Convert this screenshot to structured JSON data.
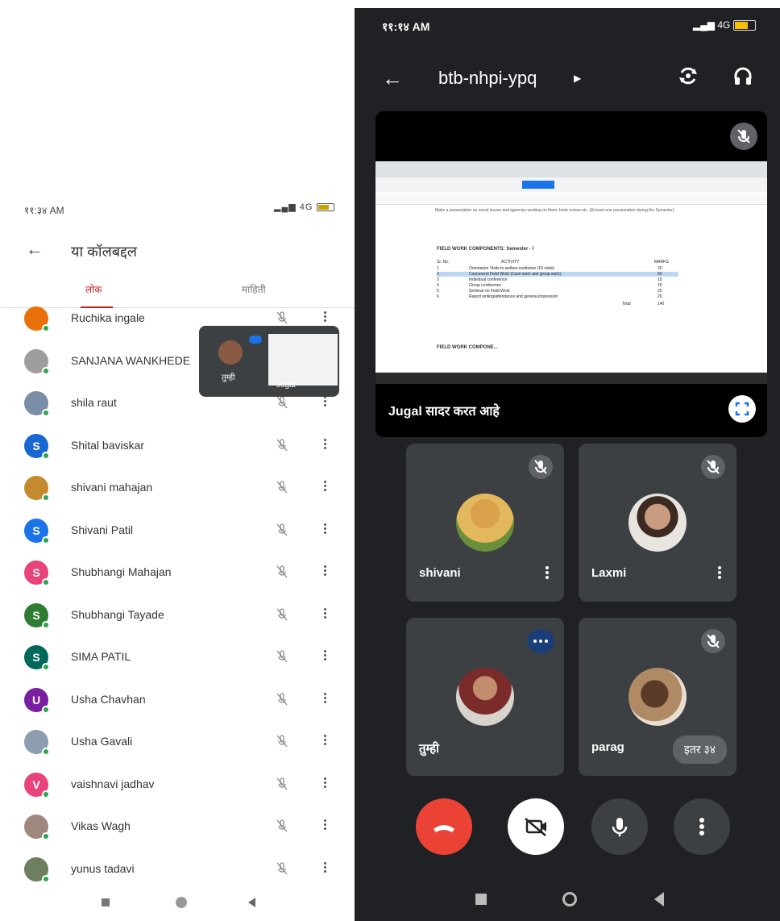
{
  "left_phone": {
    "status": {
      "time": "११:३४ AM",
      "signal": "4G"
    },
    "header": {
      "title": "या कॉलबद्दल"
    },
    "tabs": [
      {
        "label": "लोक",
        "active": true
      },
      {
        "label": "माहिती",
        "active": false
      }
    ],
    "participants": [
      {
        "name": "Ruchika ingale",
        "initial": "",
        "avatar_color": "#e8710a",
        "muted": true
      },
      {
        "name": "SANJANA WANKHEDE",
        "initial": "",
        "avatar_color": "#9e9e9e",
        "muted": true
      },
      {
        "name": "shila raut",
        "initial": "",
        "avatar_color": "#7a8fa6",
        "muted": true
      },
      {
        "name": "Shital baviskar",
        "initial": "S",
        "avatar_color": "#1967d2",
        "muted": true
      },
      {
        "name": "shivani mahajan",
        "initial": "",
        "avatar_color": "#c58a2e",
        "muted": true
      },
      {
        "name": "Shivani Patil",
        "initial": "S",
        "avatar_color": "#1a73e8",
        "muted": true
      },
      {
        "name": "Shubhangi Mahajan",
        "initial": "S",
        "avatar_color": "#e8437a",
        "muted": true
      },
      {
        "name": "Shubhangi Tayade",
        "initial": "S",
        "avatar_color": "#2e7d32",
        "muted": true
      },
      {
        "name": "SIMA PATIL",
        "initial": "S",
        "avatar_color": "#00695c",
        "muted": true
      },
      {
        "name": "Usha Chavhan",
        "initial": "U",
        "avatar_color": "#7b1fa2",
        "muted": true
      },
      {
        "name": "Usha Gavali",
        "initial": "",
        "avatar_color": "#8d9db0",
        "muted": true
      },
      {
        "name": "vaishnavi jadhav",
        "initial": "V",
        "avatar_color": "#e8437a",
        "muted": true
      },
      {
        "name": "Vikas Wagh",
        "initial": "",
        "avatar_color": "#a1887f",
        "muted": true
      },
      {
        "name": "yunus tadavi",
        "initial": "",
        "avatar_color": "#6d7f5f",
        "muted": true
      }
    ],
    "pip": {
      "self_label": "तुम्ही",
      "presenter_label": "Jugal"
    }
  },
  "right_phone": {
    "status": {
      "time": "११:१४ AM",
      "signal": "4G"
    },
    "meeting_code": "btb-nhpi-ypq",
    "presentation": {
      "caption": "Jugal सादर करत आहे",
      "doc_intro": "Make a presentation on social issues and agencies working on them; book review etc. (At least one presentation during the Semester)",
      "heading1": "FIELD WORK COMPONENTS: Semester - I",
      "table_headers": [
        "Sr. No.",
        "ACTIVITY",
        "MARKS"
      ],
      "table_rows": [
        {
          "no": "1",
          "activity": "Orientation Visits to welfare institution (10 visits)",
          "marks": "20"
        },
        {
          "no": "2",
          "activity": "Concurrent Field Work (Case work and group work)",
          "marks": "50"
        },
        {
          "no": "3",
          "activity": "Individual conference",
          "marks": "15"
        },
        {
          "no": "4",
          "activity": "Group conference",
          "marks": "15"
        },
        {
          "no": "5",
          "activity": "Seminar on Field Work",
          "marks": "20"
        },
        {
          "no": "6",
          "activity": "Report writing/attendance and general impression",
          "marks": "20"
        }
      ],
      "total_label": "Total",
      "total_value": "140",
      "heading2": "FIELD WORK COMPONE..."
    },
    "tiles": [
      {
        "name": "shivani",
        "muted": true,
        "kebab": true
      },
      {
        "name": "Laxmi",
        "muted": true,
        "kebab": true
      },
      {
        "name": "तुम्ही",
        "speaking": true
      },
      {
        "name": "parag",
        "muted": true,
        "more_label": "इतर ३४"
      }
    ],
    "controls": [
      "end-call",
      "camera-off",
      "microphone",
      "more-options"
    ]
  }
}
